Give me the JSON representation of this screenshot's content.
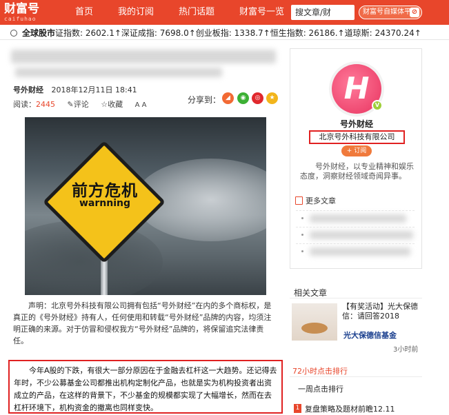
{
  "header": {
    "logo": "财富号",
    "logo_sub": "caifuhao",
    "nav": [
      "首页",
      "我的订阅",
      "热门话题",
      "财富号一览"
    ],
    "search_placeholder": "搜文章/财",
    "platform_label": "财富号自媒体平台",
    "accent_color": "#e8462b"
  },
  "ticker": {
    "title": "全球股市",
    "line": "证指数: 2602.1↑深证成指: 7698.0↑创业板指: 1338.7↑恒生指数: 26186.↑道琼斯: 24370.24↑"
  },
  "article": {
    "source": "号外财经",
    "date": "2018年12月11日 18:41",
    "reads_label": "阅读：",
    "reads": "2445",
    "comment": "评论",
    "favorite": "收藏",
    "font": "A A",
    "share_label": "分享到：",
    "image_text_cn": "前方危机",
    "image_text_en": "warnning",
    "notice": "声明：北京号外科技有限公司拥有包括“号外财经”在内的多个商标权，是真正的《号外财经》持有人，任何使用和转载“号外财经”品牌的内容，均须注明正确的来源。对于仿冒和侵权我方“号外财经”品牌的，将保留追究法律责任。",
    "body": "今年A股的下跌，有很大一部分原因在于金融去杠杆这一大趋势。还记得去年时，不少公募基金公司都推出机构定制化产品，也就是实为机构投资者出资成立的产品，在这样的背景下，不少基金的规模都实现了大幅增长，然而在去杠杆环境下，机构资金的撤离也同样变快。"
  },
  "profile": {
    "name": "号外财经",
    "company": "北京号外科技有限公司",
    "follow": "+ 订阅",
    "description": "号外财经，以专业精神和娱乐态度，洞察财经领域奇闻异事。",
    "more_label": "更多文章"
  },
  "related": {
    "title": "相关文章",
    "item_text": "【有奖活动】光大保德信：请回答2018",
    "item_source": "光大保德信基金",
    "item_time": "3小时前"
  },
  "rank": {
    "title": "72小时点击排行",
    "tab": "一周点击排行",
    "item_num": "1",
    "item_text": "复盘策略及题材前瞻12.11"
  }
}
